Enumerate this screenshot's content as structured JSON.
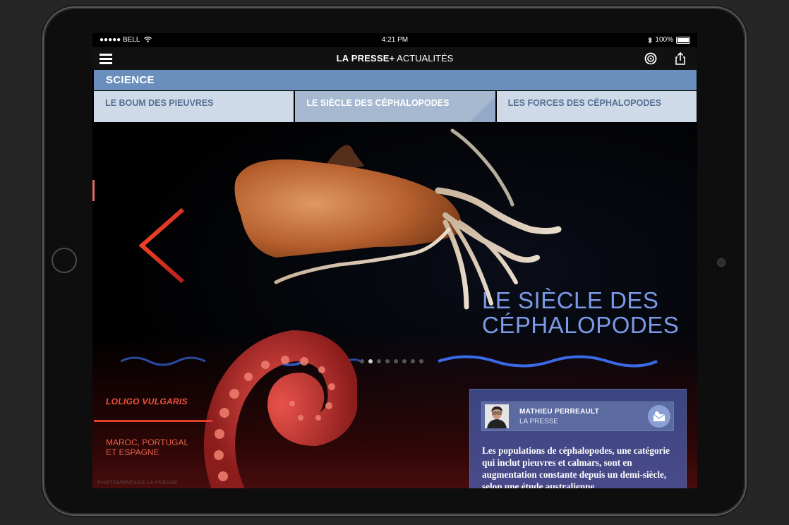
{
  "status_bar": {
    "carrier": "●●●●● BELL",
    "time": "4:21 PM",
    "battery": "100%"
  },
  "navbar": {
    "brand": "LA PRESSE",
    "brand_plus": "+",
    "brand_section": " ACTUALITÉS"
  },
  "section": {
    "label": "SCIENCE"
  },
  "tabs": [
    {
      "label": "LE BOUM DES PIEUVRES",
      "active": false
    },
    {
      "label": "LE SIÈCLE DES CÉPHALOPODES",
      "active": true
    },
    {
      "label": "LES FORCES DES CÉPHALOPODES",
      "active": false
    }
  ],
  "hero": {
    "title_line1": "LE SIÈCLE DES",
    "title_line2": "CÉPHALOPODES",
    "species": "LOLIGO VULGARIS",
    "region_line1": "MAROC, PORTUGAL",
    "region_line2": "ET ESPAGNE",
    "credit": "PHOTOMONTAGE LA PRESSE",
    "page_count": 8,
    "current_page": 1
  },
  "article": {
    "author_name": "MATHIEU PERREAULT",
    "author_org": "LA PRESSE",
    "lede": "Les populations de céphalopodes, une catégorie qui inclut pieuvres et calmars, sont en augmentation constante depuis un demi-siècle, selon une étude australienne"
  },
  "icons": {
    "menu": "hamburger-menu-icon",
    "audio": "audio-listen-icon",
    "share": "share-icon",
    "back": "chevron-left-icon",
    "contact": "contact-card-icon"
  },
  "colors": {
    "section_blue": "#6b8fbc",
    "tab_bg": "#cfdae8",
    "tab_active": "#a7b9d1",
    "title_blue": "#7c9ae8",
    "accent_red": "#e0412f"
  }
}
